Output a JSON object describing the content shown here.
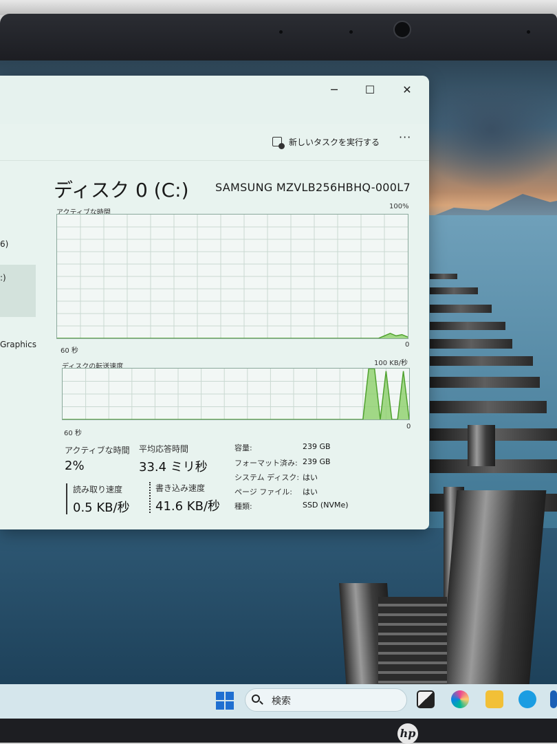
{
  "window": {
    "controls": {
      "minimize": "─",
      "maximize": "☐",
      "close": "✕"
    },
    "toolbar": {
      "run_new_task": "新しいタスクを実行する",
      "more": "···"
    }
  },
  "sidebar": {
    "items": [
      {
        "label": "6)"
      },
      {
        "label": ":)"
      },
      {
        "label": "Graphics"
      }
    ]
  },
  "disk": {
    "title": "ディスク 0 (C:)",
    "model": "SAMSUNG MZVLB256HBHQ-000L7"
  },
  "charts": {
    "active_time": {
      "label": "アクティブな時間",
      "max_label": "100%",
      "x_left": "60 秒",
      "x_right": "0"
    },
    "transfer": {
      "label": "ディスクの転送速度",
      "max_label": "100 KB/秒",
      "x_left": "60 秒",
      "x_right": "0"
    }
  },
  "chart_data": [
    {
      "type": "area",
      "title": "アクティブな時間",
      "ylim": [
        0,
        100
      ],
      "x": [
        60,
        5,
        3,
        2,
        1,
        0
      ],
      "values": [
        0,
        0,
        4,
        2,
        3,
        1
      ],
      "grid": true,
      "color": "#8ccf6a"
    },
    {
      "type": "area",
      "title": "ディスクの転送速度",
      "ylim": [
        0,
        100
      ],
      "x": [
        60,
        8,
        7,
        6,
        5,
        4,
        3,
        2,
        1,
        0
      ],
      "values": [
        0,
        0,
        100,
        100,
        0,
        95,
        0,
        0,
        95,
        0
      ],
      "grid": true,
      "color": "#8ccf6a"
    }
  ],
  "stats": {
    "active_time": {
      "label": "アクティブな時間",
      "value": "2%"
    },
    "avg_response": {
      "label": "平均応答時間",
      "value": "33.4 ミリ秒"
    },
    "read_speed": {
      "label": "読み取り速度",
      "value": "0.5 KB/秒"
    },
    "write_speed": {
      "label": "書き込み速度",
      "value": "41.6 KB/秒"
    }
  },
  "properties": [
    {
      "key": "容量:",
      "value": "239 GB"
    },
    {
      "key": "フォーマット済み:",
      "value": "239 GB"
    },
    {
      "key": "システム ディスク:",
      "value": "はい"
    },
    {
      "key": "ページ ファイル:",
      "value": "はい"
    },
    {
      "key": "種類:",
      "value": "SSD (NVMe)"
    }
  ],
  "taskbar": {
    "search_placeholder": "検索",
    "colors": {
      "windows": "#1f6fd1",
      "explorer": "#f2c037",
      "edge": "#1b9de2"
    }
  },
  "brand": {
    "logo": "hp"
  }
}
